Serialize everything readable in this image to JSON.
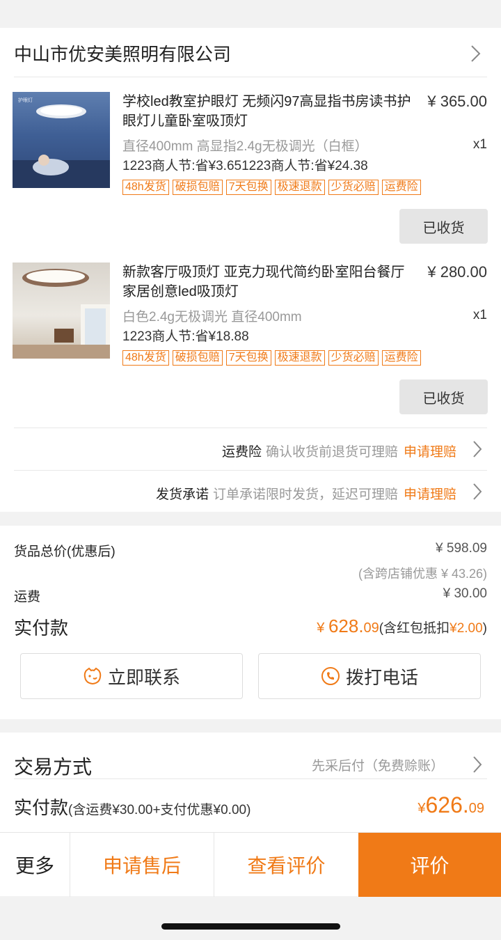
{
  "store": {
    "name": "中山市优安美照明有限公司"
  },
  "products": [
    {
      "title": "学校led教室护眼灯 无频闪97高显指书房读书护眼灯儿童卧室吸顶灯",
      "price": "¥ 365.00",
      "spec": "直径400mm 高显指2.4g无极调光（白框）",
      "qty": "x1",
      "promo": "1223商人节:省¥3.651223商人节:省¥24.38",
      "tags": [
        "48h发货",
        "破损包赔",
        "7天包换",
        "极速退款",
        "少货必赔",
        "运费险"
      ],
      "status_button": "已收货",
      "thumb_label": "护眼灯"
    },
    {
      "title": "新款客厅吸顶灯 亚克力现代简约卧室阳台餐厅家居创意led吸顶灯",
      "price": "¥ 280.00",
      "spec": "白色2.4g无极调光 直径400mm",
      "qty": "x1",
      "promo": "1223商人节:省¥18.88",
      "tags": [
        "48h发货",
        "破损包赔",
        "7天包换",
        "极速退款",
        "少货必赔",
        "运费险"
      ],
      "status_button": "已收货"
    }
  ],
  "services": [
    {
      "name": "运费险",
      "desc": "确认收货前退货可理赔",
      "action": "申请理赔"
    },
    {
      "name": "发货承诺",
      "desc": "订单承诺限时发货，延迟可理赔",
      "action": "申请理赔"
    }
  ],
  "summary": {
    "goods_total_label": "货品总价(优惠后)",
    "goods_total_value": "¥ 598.09",
    "cross_store_discount": "(含跨店铺优惠 ¥ 43.26)",
    "shipping_label": "运费",
    "shipping_value": "¥ 30.00",
    "paid_label": "实付款",
    "paid_currency": "¥ ",
    "paid_integer": "628.",
    "paid_decimal": "09",
    "paid_note_prefix": "(含红包抵扣",
    "paid_note_amount": "¥2.00",
    "paid_note_suffix": ")"
  },
  "contact": {
    "chat_label": "立即联系",
    "call_label": "拨打电话"
  },
  "trade": {
    "label": "交易方式",
    "value": "先采后付（免费赊账）",
    "paid_label": "实付款",
    "paid_detail": "(含运费¥30.00+支付优惠¥0.00)",
    "paid_currency": "¥",
    "paid_integer": "626.",
    "paid_decimal": "09"
  },
  "bottom_bar": {
    "more": "更多",
    "after_sale": "申请售后",
    "view_review": "查看评价",
    "review": "评价"
  },
  "colors": {
    "accent": "#f07a17",
    "primary_button": "#f07a17"
  }
}
